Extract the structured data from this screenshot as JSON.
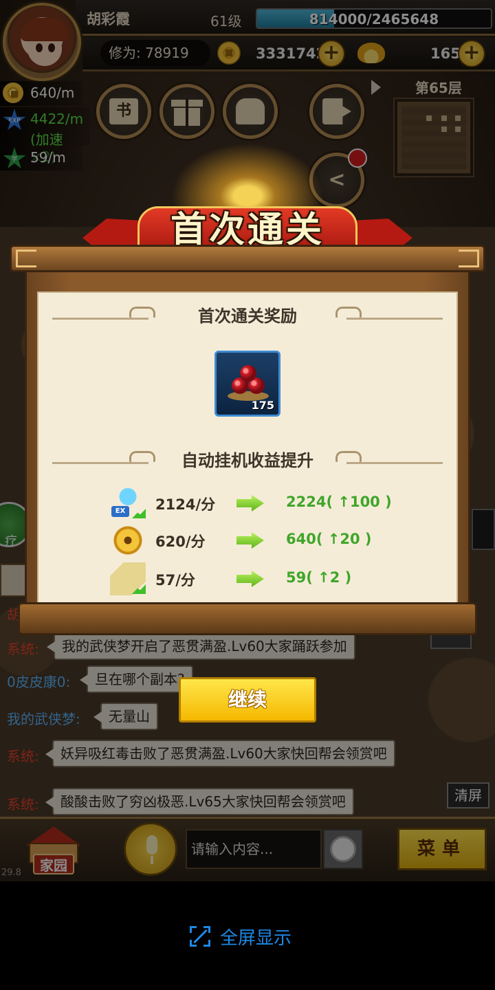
{
  "player": {
    "name": "胡彩霞",
    "level": "61级",
    "exp_text": "814000/2465648",
    "exp_fraction": 0.33,
    "cultivation": "修为: 78919"
  },
  "currency": {
    "coins": "3331742",
    "ingots": "165"
  },
  "rates": {
    "coin": "640/m",
    "exp": "4422/m",
    "exp_boost": "(加速 ×2)",
    "learn": "59/m",
    "exp_badge": "EXP",
    "learn_badge": "学"
  },
  "toolbar": {
    "book_glyph": "书"
  },
  "floor": {
    "label": "第65层"
  },
  "modal": {
    "title": "首次通关",
    "reward_heading": "首次通关奖励",
    "reward_item_count": "175",
    "boost_heading": "自动挂机收益提升",
    "stats": [
      {
        "icon": "exp-icon",
        "old": "2124/分",
        "new": "2224( ↑100 )"
      },
      {
        "icon": "coin-icon",
        "old": "620/分",
        "new": "640( ↑20 )"
      },
      {
        "icon": "scroll-icon",
        "old": "57/分",
        "new": "59( ↑2 )"
      }
    ],
    "continue_label": "继续"
  },
  "chat": {
    "partial_name": "胡",
    "side_label": "疗",
    "messages": [
      {
        "sender": "系统:",
        "text": "我的武侠梦开启了恶贯满盈.Lv60大家踊跃参加",
        "type": "system"
      },
      {
        "sender": "0皮皮康0:",
        "text": "旦在哪个副本?",
        "type": "user"
      },
      {
        "sender": "我的武侠梦:",
        "text": "无量山",
        "type": "user"
      },
      {
        "sender": "系统:",
        "text": "妖异吸红毒击败了恶贯满盈.Lv60大家快回帮会领赏吧",
        "type": "system"
      },
      {
        "sender": "系统:",
        "text": "酸酸击败了穷凶极恶.Lv65大家快回帮会领赏吧",
        "type": "system"
      }
    ],
    "clear_label": "清屏",
    "input_placeholder": "请输入内容...",
    "colors": {
      "system": "#e8432e",
      "user": "#5eb6ff"
    }
  },
  "bottom": {
    "home_label": "家园",
    "menu_label": "菜单",
    "fps": "29.8"
  },
  "footer": {
    "fullscreen_label": "全屏显示"
  }
}
